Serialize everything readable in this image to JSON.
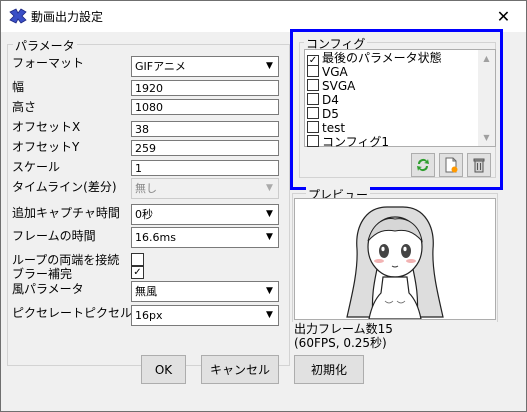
{
  "window": {
    "title": "動画出力設定",
    "close_glyph": "✕"
  },
  "params": {
    "group_label": "パラメータ",
    "format_label": "フォーマット",
    "format_value": "GIFアニメ",
    "width_label": "幅",
    "width_value": "1920",
    "height_label": "高さ",
    "height_value": "1080",
    "offx_label": "オフセットX",
    "offx_value": "38",
    "offy_label": "オフセットY",
    "offy_value": "259",
    "scale_label": "スケール",
    "scale_value": "1",
    "timeline_label": "タイムライン(差分)",
    "timeline_value": "無し",
    "capture_label": "追加キャプチャ時間",
    "capture_value": "0秒",
    "frametime_label": "フレームの時間",
    "frametime_value": "16.6ms",
    "loop_label": "ループの両端を接続",
    "loop_checked": false,
    "blur_label": "ブラー補完",
    "blur_checked": true,
    "wind_label": "風パラメータ",
    "wind_value": "無風",
    "pixel_label": "ピクセレートピクセル数",
    "pixel_value": "16px"
  },
  "config": {
    "group_label": "コンフィグ",
    "items": [
      {
        "label": "最後のパラメータ状態",
        "checked": true
      },
      {
        "label": "VGA",
        "checked": false
      },
      {
        "label": "SVGA",
        "checked": false
      },
      {
        "label": "D4",
        "checked": false
      },
      {
        "label": "D5",
        "checked": false
      },
      {
        "label": "test",
        "checked": false
      },
      {
        "label": "コンフィグ1",
        "checked": false
      }
    ],
    "icons": [
      "refresh-icon",
      "new-file-icon",
      "delete-icon"
    ]
  },
  "preview": {
    "group_label": "プレビュー",
    "info_line1": "出力フレーム数15",
    "info_line2": "(60FPS, 0.25秒)"
  },
  "buttons": {
    "ok": "OK",
    "cancel": "キャンセル",
    "reset": "初期化"
  },
  "check_glyph": "✓"
}
